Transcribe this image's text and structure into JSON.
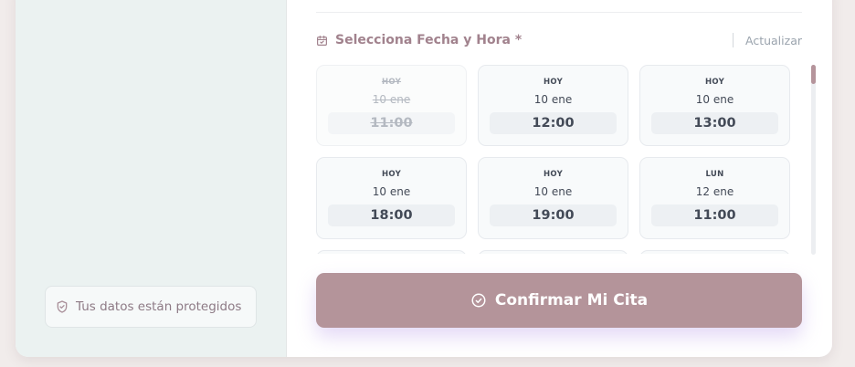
{
  "left_panel": {
    "security_badge": {
      "text": "Tus datos están protegidos",
      "icon": "shield-check-icon"
    }
  },
  "schedule": {
    "title": "Selecciona Fecha y Hora *",
    "title_icon": "calendar-icon",
    "refresh_label": "Actualizar",
    "slots": [
      {
        "day": "HOY",
        "date": "10 ene",
        "time": "11:00",
        "available": false
      },
      {
        "day": "HOY",
        "date": "10 ene",
        "time": "12:00",
        "available": true
      },
      {
        "day": "HOY",
        "date": "10 ene",
        "time": "13:00",
        "available": true
      },
      {
        "day": "HOY",
        "date": "10 ene",
        "time": "18:00",
        "available": true
      },
      {
        "day": "HOY",
        "date": "10 ene",
        "time": "19:00",
        "available": true
      },
      {
        "day": "LUN",
        "date": "12 ene",
        "time": "11:00",
        "available": true
      },
      {
        "day": "",
        "date": "",
        "time": "",
        "available": true
      },
      {
        "day": "",
        "date": "",
        "time": "",
        "available": true
      },
      {
        "day": "",
        "date": "",
        "time": "",
        "available": true
      }
    ]
  },
  "confirm_button": {
    "label": "Confirmar Mi Cita",
    "icon": "check-circle-icon"
  },
  "colors": {
    "accent": "#b4949a",
    "title": "#a1828d",
    "left_panel_bg": "#ebf2f1",
    "page_bg": "#f1eceb"
  }
}
